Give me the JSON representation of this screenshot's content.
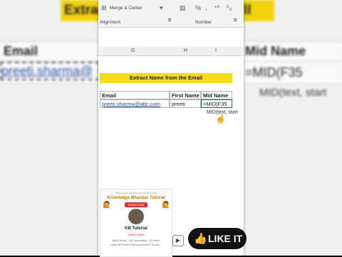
{
  "background": {
    "title_left": "Extrac",
    "title_right": "ll",
    "col_email": "Email",
    "col_mid_name": "Mid Name",
    "email_value": "preeti.sharma@",
    "mid_formula": "=MID(F35",
    "hint": "MID(text, start"
  },
  "ribbon": {
    "merge_center": "Merge & Center",
    "alignment": "Alignment",
    "number": "Number"
  },
  "columns": [
    "G",
    "H",
    "I"
  ],
  "banner": "Extract Name from the Email",
  "table": {
    "headers": [
      "Email",
      "First Name",
      "Mid Name"
    ],
    "row": [
      "preeti.sharma@abc.com",
      "preeti",
      "=MID(F35"
    ]
  },
  "tooltip": "MID(text, start",
  "card": {
    "url": "https://www.youtube.com/c/KBTutorial",
    "title": "Knowledge Bhandar Tutorial",
    "subscribe_badge": "SUBSCRIBE",
    "name": "KB Tutorial",
    "subscribe": "SUBSCRIBE",
    "line1": "@KBTutorial · 1.5K subscribers · 90 videos",
    "line2": "Learn MS Excel & Microsoft Excel & Tutorial..."
  },
  "like_label": "LIKE IT",
  "colors": {
    "accent": "#f5dc17",
    "link": "#2a4fa0",
    "active": "#217346"
  }
}
